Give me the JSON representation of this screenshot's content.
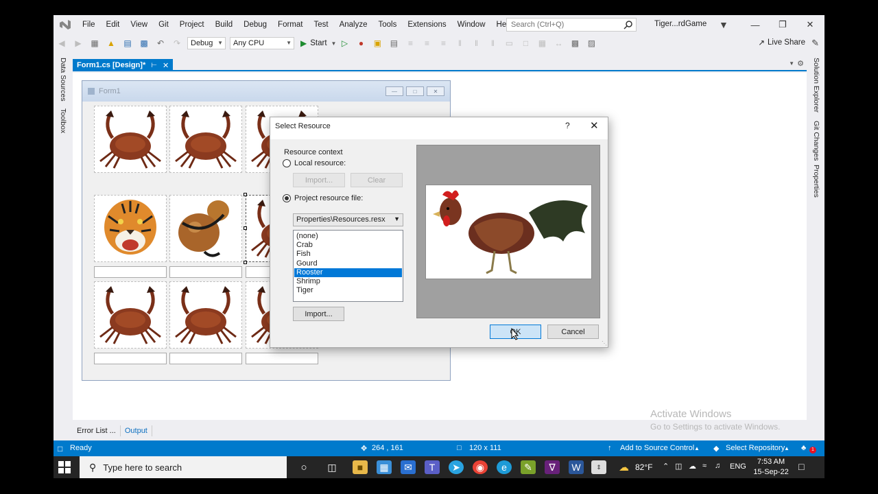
{
  "menu": [
    "File",
    "Edit",
    "View",
    "Git",
    "Project",
    "Build",
    "Debug",
    "Format",
    "Test",
    "Analyze",
    "Tools",
    "Extensions",
    "Window",
    "Help"
  ],
  "search": {
    "placeholder": "Search (Ctrl+Q)"
  },
  "app_title": "Tiger...rdGame",
  "toolbar": {
    "config": "Debug",
    "platform": "Any CPU",
    "start": "Start",
    "live_share": "Live Share"
  },
  "left_tabs": [
    "Data Sources",
    "Toolbox"
  ],
  "right_tabs": [
    "Solution Explorer",
    "Git Changes",
    "Properties"
  ],
  "doc_tab": {
    "title": "Form1.cs [Design]*"
  },
  "form": {
    "title": "Form1"
  },
  "picture_grid": [
    [
      "crab",
      "crab",
      "crab"
    ],
    [
      "tiger",
      "gourd",
      "crab"
    ],
    [
      "crab",
      "crab",
      "crab"
    ]
  ],
  "bottom_tabs": [
    "Error List ...",
    "Output"
  ],
  "watermark": {
    "line1": "Activate Windows",
    "line2": "Go to Settings to activate Windows."
  },
  "status": {
    "ready": "Ready",
    "position": "264 , 161",
    "size": "120 x 111",
    "source_control": "Add to Source Control",
    "repository": "Select Repository",
    "notifications": "1"
  },
  "dialog": {
    "title": "Select Resource",
    "help": "?",
    "context_label": "Resource context",
    "local_label": "Local resource:",
    "import_disabled": "Import...",
    "clear_disabled": "Clear",
    "project_label": "Project resource file:",
    "resx_file": "Properties\\Resources.resx",
    "resources": [
      "(none)",
      "Crab",
      "Fish",
      "Gourd",
      "Rooster",
      "Shrimp",
      "Tiger"
    ],
    "selected_resource": "Rooster",
    "import_button": "Import...",
    "ok": "OK",
    "cancel": "Cancel"
  },
  "taskbar": {
    "search_placeholder": "Type here to search",
    "temperature": "82°F",
    "language": "ENG",
    "time": "7:53 AM",
    "date": "15-Sep-22"
  },
  "colors": {
    "accent": "#007acc",
    "selection": "#0078d7",
    "vs_purple": "#68217a"
  }
}
